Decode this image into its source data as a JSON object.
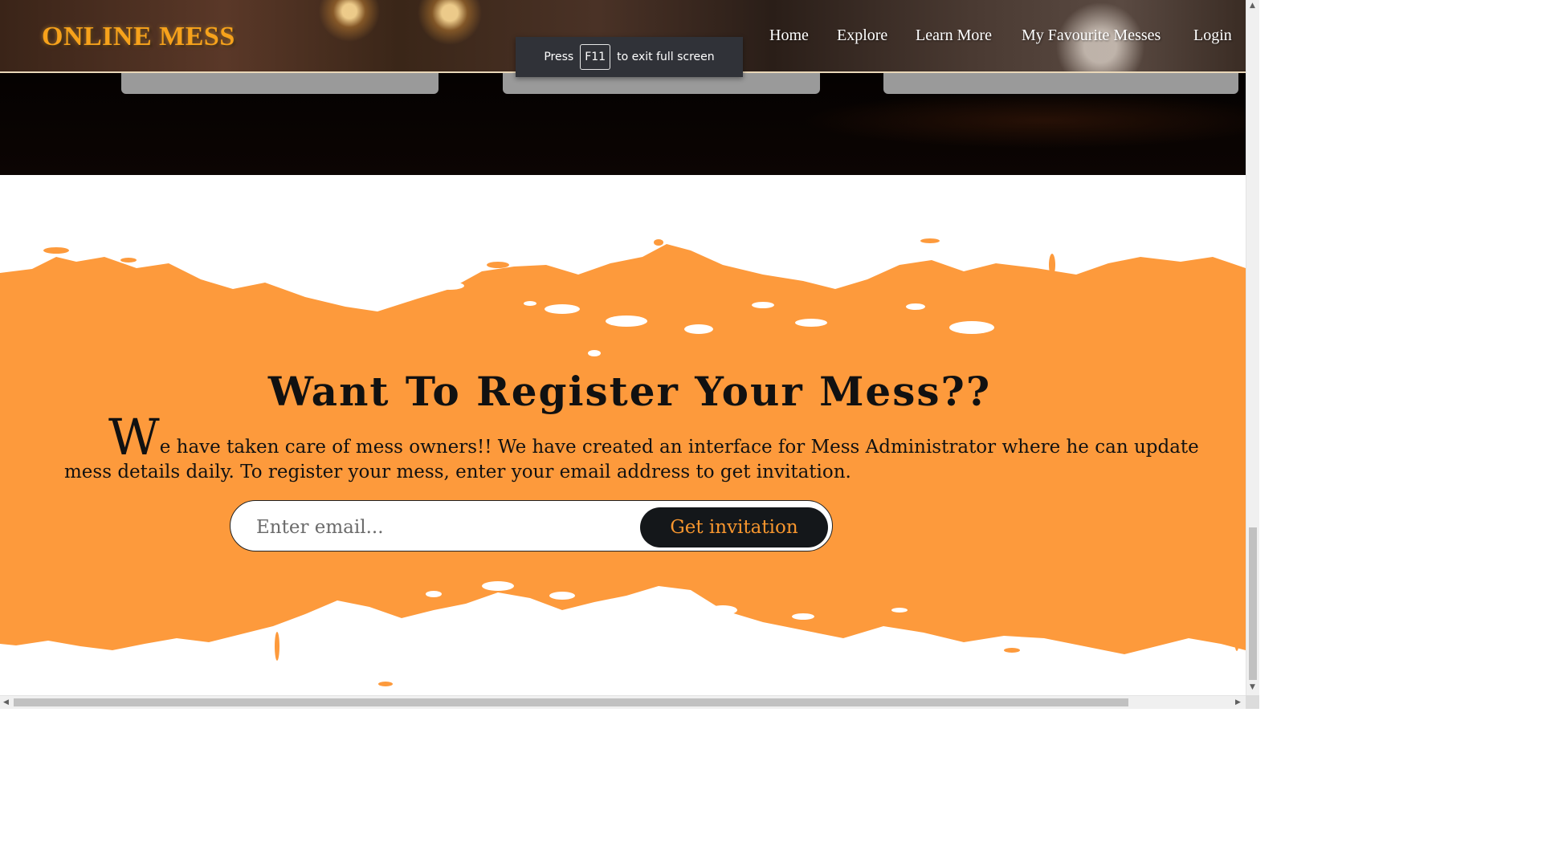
{
  "brand": {
    "title": "ONLINE MESS",
    "color": "#f7a21b"
  },
  "nav": {
    "items": [
      {
        "label": "Home"
      },
      {
        "label": "Explore"
      },
      {
        "label": "Learn More"
      },
      {
        "label": "My Favourite Messes"
      },
      {
        "label": "Login"
      }
    ]
  },
  "fullscreen_toast": {
    "press": "Press",
    "key": "F11",
    "suffix": "to exit full screen"
  },
  "register": {
    "title": "Want To Register Your Mess??",
    "dropcap": "W",
    "text": "e have taken care of mess owners!! We have created an interface for Mess Administrator where he can update mess details daily. To register your mess, enter your email address to get invitation.",
    "email_placeholder": "Enter email...",
    "email_value": "",
    "button_label": "Get invitation"
  },
  "colors": {
    "accent_orange": "#fd9a3c",
    "button_bg": "#14171a",
    "button_text": "#f7962e"
  },
  "icons": {
    "scroll_up": "scroll-up-arrow-icon",
    "scroll_down": "scroll-down-arrow-icon",
    "scroll_left": "scroll-left-arrow-icon",
    "scroll_right": "scroll-right-arrow-icon"
  }
}
